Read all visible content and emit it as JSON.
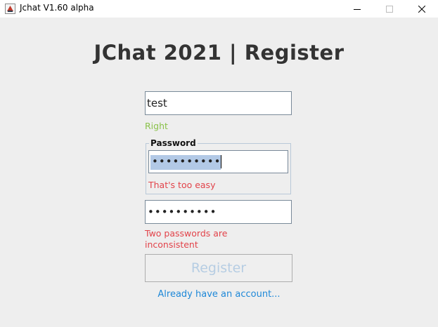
{
  "window": {
    "title": "Jchat V1.60 alpha",
    "icon": "java-app-icon"
  },
  "heading": "JChat 2021 | Register",
  "username": {
    "value": "test",
    "status": "Right",
    "status_color": "#8ac249"
  },
  "password": {
    "group_label": "Password",
    "value_masked": "••••••••••",
    "selected": true,
    "status": "That's too easy",
    "status_color": "#e2434a"
  },
  "confirm_password": {
    "value_masked": "••••••••••",
    "status": "Two passwords are inconsistent",
    "status_color": "#e2434a"
  },
  "register_button": {
    "label": "Register",
    "enabled": false
  },
  "login_link": "Already have an account...",
  "colors": {
    "background": "#eeeeee",
    "heading": "#333333",
    "link": "#1e88d8",
    "button_text_disabled": "#b6cde3"
  }
}
